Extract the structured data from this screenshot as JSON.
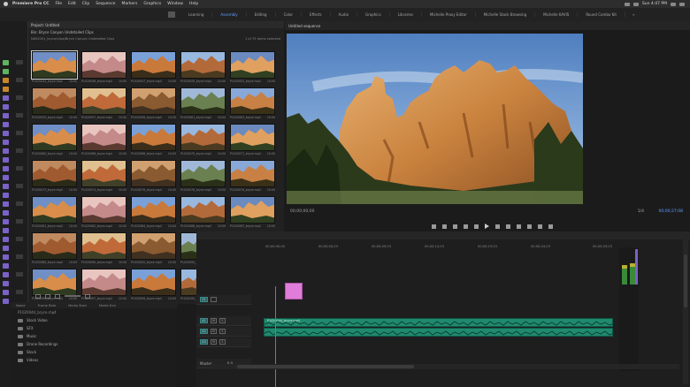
{
  "menubar": {
    "app": "Premiere Pro CC",
    "items": [
      "File",
      "Edit",
      "Clip",
      "Sequence",
      "Markers",
      "Graphics",
      "Window",
      "Help"
    ],
    "clock": "Sun 4:47 PM"
  },
  "workspaces": {
    "items": [
      "Learning",
      "Assembly",
      "Editing",
      "Color",
      "Effects",
      "Audio",
      "Graphics",
      "Libraries",
      "Michelle Proxy Editor",
      "Michelle Stock Browsing",
      "Michelle KAVIS",
      "Round Combo Kit"
    ],
    "active_index": 1,
    "more": "»"
  },
  "project": {
    "tab": "Project: Untitled",
    "bin_title": "Bin: Bryce Canyon Undetailed Clips",
    "path": "N002001_bryce/clips/Bryce Canyon Undetailed Clips",
    "count": "1 of 75 items selected",
    "thumbnails": [
      {
        "name": "P1020044_bryce.mp4",
        "dur": "10:00"
      },
      {
        "name": "P1020046_bryce.mp4",
        "dur": "10:00"
      },
      {
        "name": "P1020047_bryce.mp4",
        "dur": "10:00"
      },
      {
        "name": "P1020049_bryce.mp4",
        "dur": "10:00"
      },
      {
        "name": "P1020052_bryce.mp4",
        "dur": "10:00"
      },
      {
        "name": "P1020055_bryce.mp4",
        "dur": "10:00"
      },
      {
        "name": "P1020057_bryce.mp4",
        "dur": "10:00"
      },
      {
        "name": "P1020058_bryce.mp4",
        "dur": "10:00"
      },
      {
        "name": "P1020061_bryce.mp4",
        "dur": "10:00"
      },
      {
        "name": "P1020063_bryce.mp4",
        "dur": "10:00"
      },
      {
        "name": "P1020065_bryce.mp4",
        "dur": "10:00"
      },
      {
        "name": "P1020066_bryce.mp4",
        "dur": "10:00"
      },
      {
        "name": "P1020068_bryce.mp4",
        "dur": "10:00"
      },
      {
        "name": "P1020070_bryce.mp4",
        "dur": "10:00"
      },
      {
        "name": "P1020071_bryce.mp4",
        "dur": "10:00"
      },
      {
        "name": "P1020073_bryce.mp4",
        "dur": "10:00"
      },
      {
        "name": "P1020074_bryce.mp4",
        "dur": "10:00"
      },
      {
        "name": "P1020076_bryce.mp4",
        "dur": "10:00"
      },
      {
        "name": "P1020078_bryce.mp4",
        "dur": "10:00"
      },
      {
        "name": "P1020079_bryce.mp4",
        "dur": "10:00"
      },
      {
        "name": "P1020081_bryce.mp4",
        "dur": "10:00"
      },
      {
        "name": "P1020082_bryce.mp4",
        "dur": "10:00"
      },
      {
        "name": "P1020084_bryce.mp4",
        "dur": "10:00"
      },
      {
        "name": "P1020086_bryce.mp4",
        "dur": "10:00"
      },
      {
        "name": "P1020087_bryce.mp4",
        "dur": "10:00"
      },
      {
        "name": "P1020089_bryce.mp4",
        "dur": "10:00"
      },
      {
        "name": "P1020090_bryce.mp4",
        "dur": "10:00"
      },
      {
        "name": "P1020092_bryce.mp4",
        "dur": "10:00"
      },
      {
        "name": "P1020093_bryce.mp4",
        "dur": "10:00"
      },
      {
        "name": "P1020095_bryce.mp4",
        "dur": "10:00"
      },
      {
        "name": "P1020096_bryce.mp4",
        "dur": "10:00"
      },
      {
        "name": "P1020097_bryce.mp4",
        "dur": "10:00"
      },
      {
        "name": "P1020099_bryce.mp4",
        "dur": "10:00"
      },
      {
        "name": "P1020100_bryce.mp4",
        "dur": "10:00"
      },
      {
        "name": "P1020102_bryce.mp4",
        "dur": "10:00"
      }
    ]
  },
  "binlist": {
    "headers": [
      "Name",
      "Frame Rate",
      "Media Start",
      "Media End"
    ],
    "first_row": "P1020044_bryce.mp4",
    "rows": [
      "Stock Video",
      "SFX",
      "Music",
      "Drone Recordings",
      "Stock",
      "Videos"
    ]
  },
  "monitor": {
    "tab": "Untitled sequence",
    "timecode_left": "00;00;00;00",
    "fit": "1/4",
    "timecode_right": "00;00;27;08"
  },
  "timeline": {
    "ruler": [
      "00;00;00;00",
      "00;00;04;23",
      "00;00;09;23",
      "00;00;14;23",
      "00;00;19;23",
      "00;00;24;23",
      "00;00;29;23"
    ],
    "tracks": [
      "V1",
      "A1",
      "A2",
      "A3",
      "Master"
    ],
    "master_value": "0.0",
    "clip_label": "P1020044_bryce.mp4"
  },
  "colors": {
    "accent": "#5ea0ff",
    "audio_clip": "#1f8a6e",
    "pink_clip": "#e07cd9",
    "label_green": "#5fb35f",
    "label_purple": "#7b62c8",
    "label_orange": "#c8862b"
  }
}
